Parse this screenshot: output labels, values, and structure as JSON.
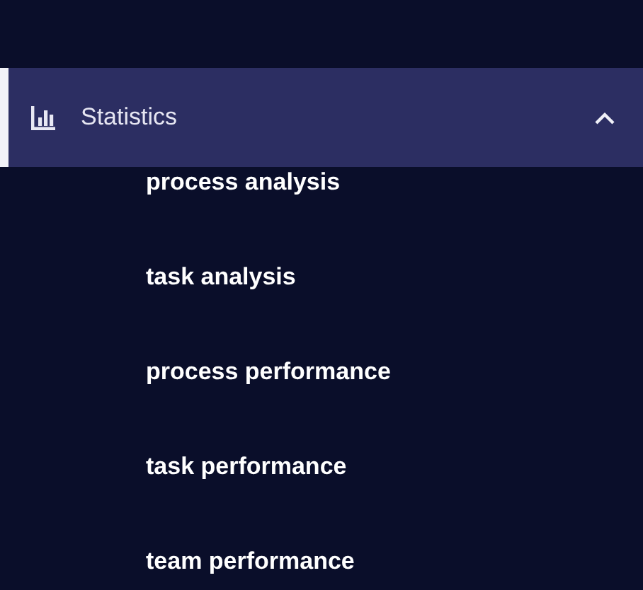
{
  "menu": {
    "label": "Statistics",
    "selected": true,
    "expanded": true,
    "children": [
      {
        "label": "process analysis"
      },
      {
        "label": "task analysis"
      },
      {
        "label": "process performance"
      },
      {
        "label": "task performance"
      },
      {
        "label": "team performance"
      }
    ]
  }
}
